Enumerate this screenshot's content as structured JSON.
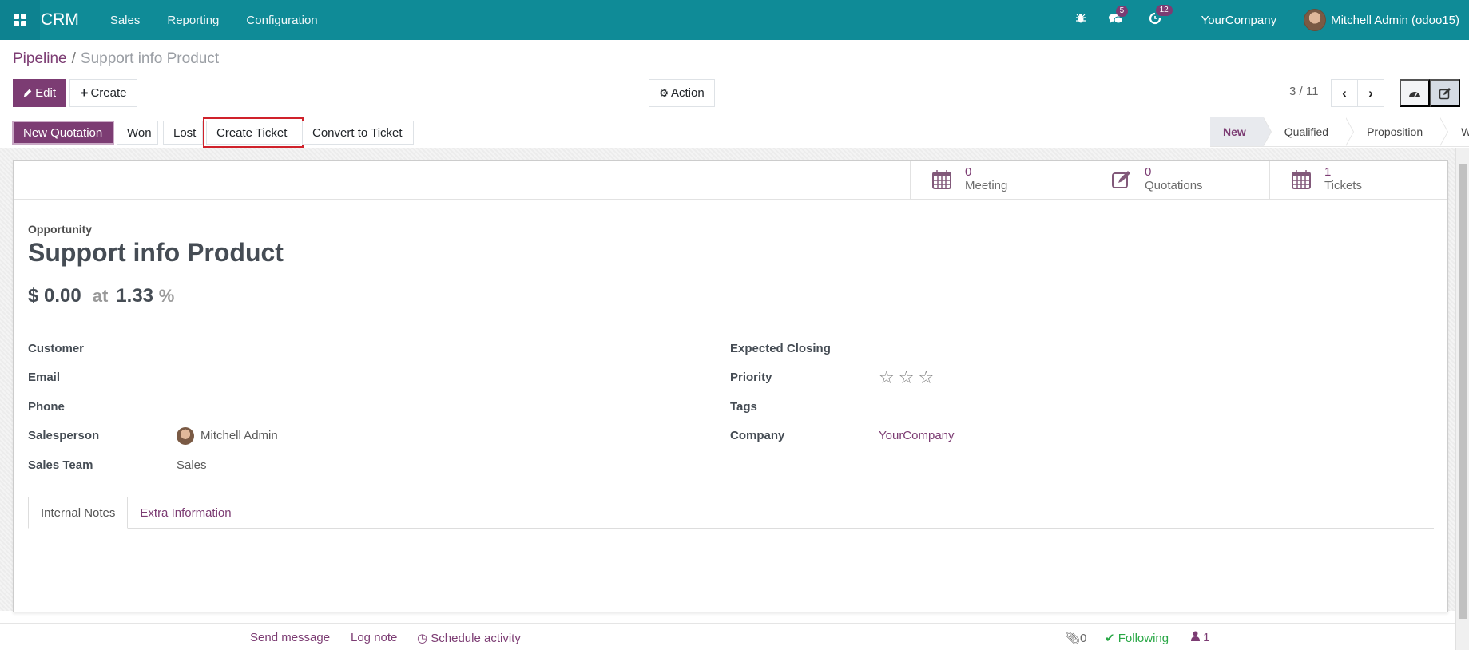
{
  "navbar": {
    "app_name": "CRM",
    "menus": [
      "Sales",
      "Reporting",
      "Configuration"
    ],
    "messages_badge": "5",
    "activities_badge": "12",
    "company": "YourCompany",
    "user": "Mitchell Admin (odoo15)"
  },
  "breadcrumb": {
    "parent": "Pipeline",
    "separator": "/",
    "current": "Support info Product"
  },
  "control_panel": {
    "edit_label": "Edit",
    "create_label": "Create",
    "action_label": "Action",
    "pager": "3 / 11"
  },
  "header_buttons": {
    "new_quotation": "New Quotation",
    "won": "Won",
    "lost": "Lost",
    "create_ticket": "Create Ticket",
    "convert_ticket": "Convert to Ticket"
  },
  "statusbar": {
    "stages": [
      "New",
      "Qualified",
      "Proposition",
      "Won"
    ],
    "active": "New"
  },
  "smart_buttons": [
    {
      "value": "0",
      "label": "Meeting",
      "icon": "calendar-icon"
    },
    {
      "value": "0",
      "label": "Quotations",
      "icon": "edit-icon"
    },
    {
      "value": "1",
      "label": "Tickets",
      "icon": "calendar-icon"
    }
  ],
  "record": {
    "kind": "Opportunity",
    "title": "Support info Product",
    "revenue": "$ 0.00",
    "at_label": "at",
    "probability": "1.33",
    "pct_symbol": "%"
  },
  "fields_left": [
    {
      "label": "Customer",
      "value": ""
    },
    {
      "label": "Email",
      "value": ""
    },
    {
      "label": "Phone",
      "value": ""
    },
    {
      "label": "Salesperson",
      "value": "Mitchell Admin"
    },
    {
      "label": "Sales Team",
      "value": "Sales"
    }
  ],
  "fields_right": [
    {
      "label": "Expected Closing",
      "value": ""
    },
    {
      "label": "Priority",
      "value": "0 of 3 stars"
    },
    {
      "label": "Tags",
      "value": ""
    },
    {
      "label": "Company",
      "value": "YourCompany"
    }
  ],
  "tabs": [
    "Internal Notes",
    "Extra Information"
  ],
  "chatter": {
    "send_message": "Send message",
    "log_note": "Log note",
    "schedule_activity": "Schedule activity",
    "attachments": "0",
    "following": "Following",
    "followers": "1"
  },
  "colors": {
    "navbar": "#0f8b97",
    "primary": "#7c3c73",
    "highlight": "#d0222b",
    "following": "#28a745"
  }
}
